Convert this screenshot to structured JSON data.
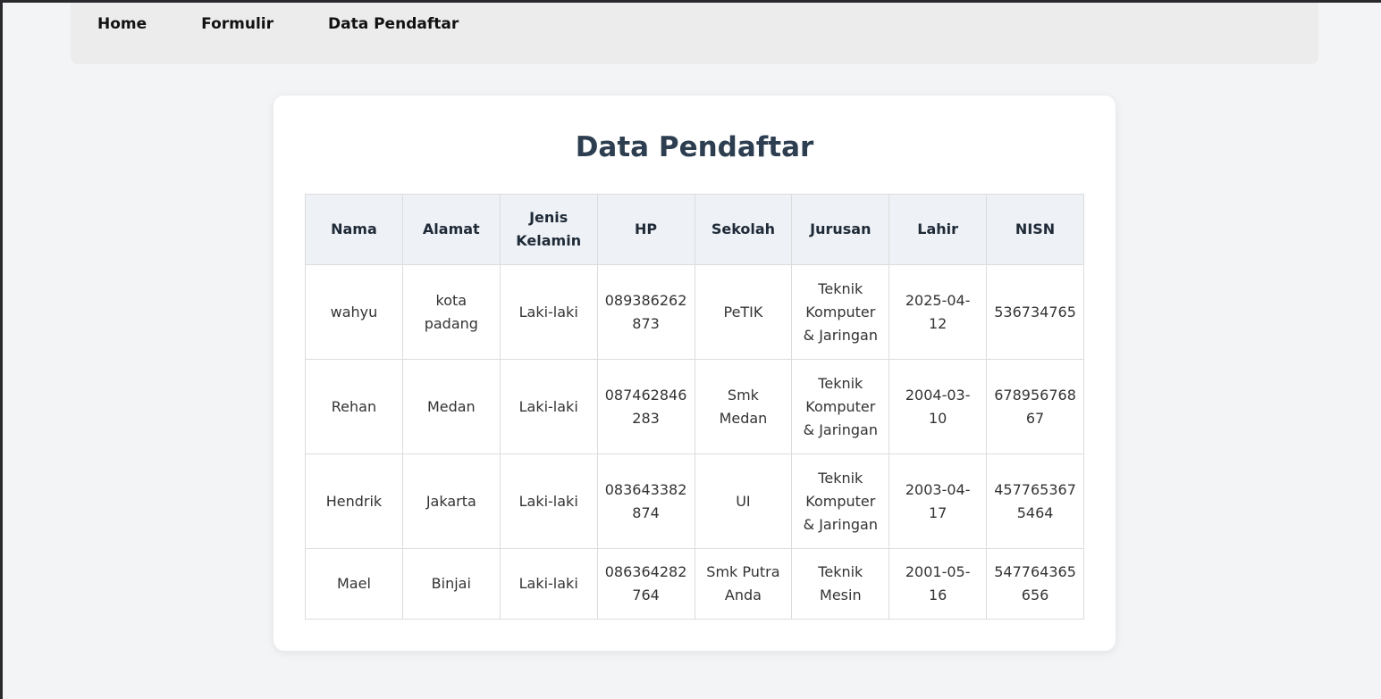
{
  "nav": {
    "items": [
      "Home",
      "Formulir",
      "Data Pendaftar"
    ]
  },
  "page": {
    "title": "Data Pendaftar"
  },
  "table": {
    "headers": [
      "Nama",
      "Alamat",
      "Jenis Kelamin",
      "HP",
      "Sekolah",
      "Jurusan",
      "Lahir",
      "NISN"
    ],
    "rows": [
      [
        "wahyu",
        "kota padang",
        "Laki-laki",
        "089386262873",
        "PeTIK",
        "Teknik Komputer & Jaringan",
        "2025-04-12",
        "536734765"
      ],
      [
        "Rehan",
        "Medan",
        "Laki-laki",
        "087462846283",
        "Smk Medan",
        "Teknik Komputer & Jaringan",
        "2004-03-10",
        "67895676867"
      ],
      [
        "Hendrik",
        "Jakarta",
        "Laki-laki",
        "083643382874",
        "UI",
        "Teknik Komputer & Jaringan",
        "2003-04-17",
        "4577653675464"
      ],
      [
        "Mael",
        "Binjai",
        "Laki-laki",
        "086364282764",
        "Smk Putra Anda",
        "Teknik Mesin",
        "2001-05-16",
        "547764365656"
      ]
    ]
  }
}
